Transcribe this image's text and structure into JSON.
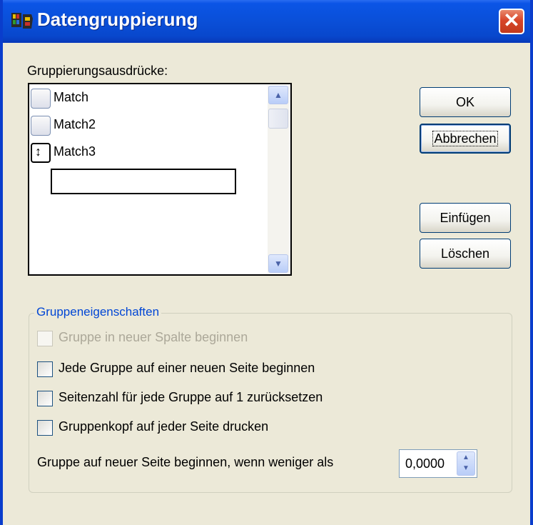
{
  "window": {
    "title": "Datengruppierung",
    "icon": "report-app-icon",
    "close_symbol": "✕"
  },
  "expressions": {
    "label": "Gruppierungsausdrücke:",
    "rows": [
      {
        "text": "Match",
        "state": "none"
      },
      {
        "text": "Match2",
        "state": "none"
      },
      {
        "text": "Match3",
        "state": "current",
        "marker": "↕"
      }
    ],
    "edit_value": ""
  },
  "buttons": {
    "ok": "OK",
    "cancel": "Abbrechen",
    "insert": "Einfügen",
    "delete": "Löschen"
  },
  "properties": {
    "title": "Gruppeneigenschaften",
    "options": [
      {
        "label": "Gruppe in neuer Spalte beginnen",
        "checked": false,
        "enabled": false
      },
      {
        "label": "Jede Gruppe auf einer neuen Seite beginnen",
        "checked": false,
        "enabled": true
      },
      {
        "label": "Seitenzahl für jede Gruppe auf 1 zurücksetzen",
        "checked": false,
        "enabled": true
      },
      {
        "label": "Gruppenkopf auf jeder Seite drucken",
        "checked": false,
        "enabled": true
      }
    ],
    "threshold_label": "Gruppe auf neuer Seite beginnen, wenn weniger als",
    "threshold_value": "0,0000"
  },
  "colors": {
    "titlebar": "#0a4fd8",
    "group_title": "#0046d5",
    "close_button": "#d8462a"
  }
}
